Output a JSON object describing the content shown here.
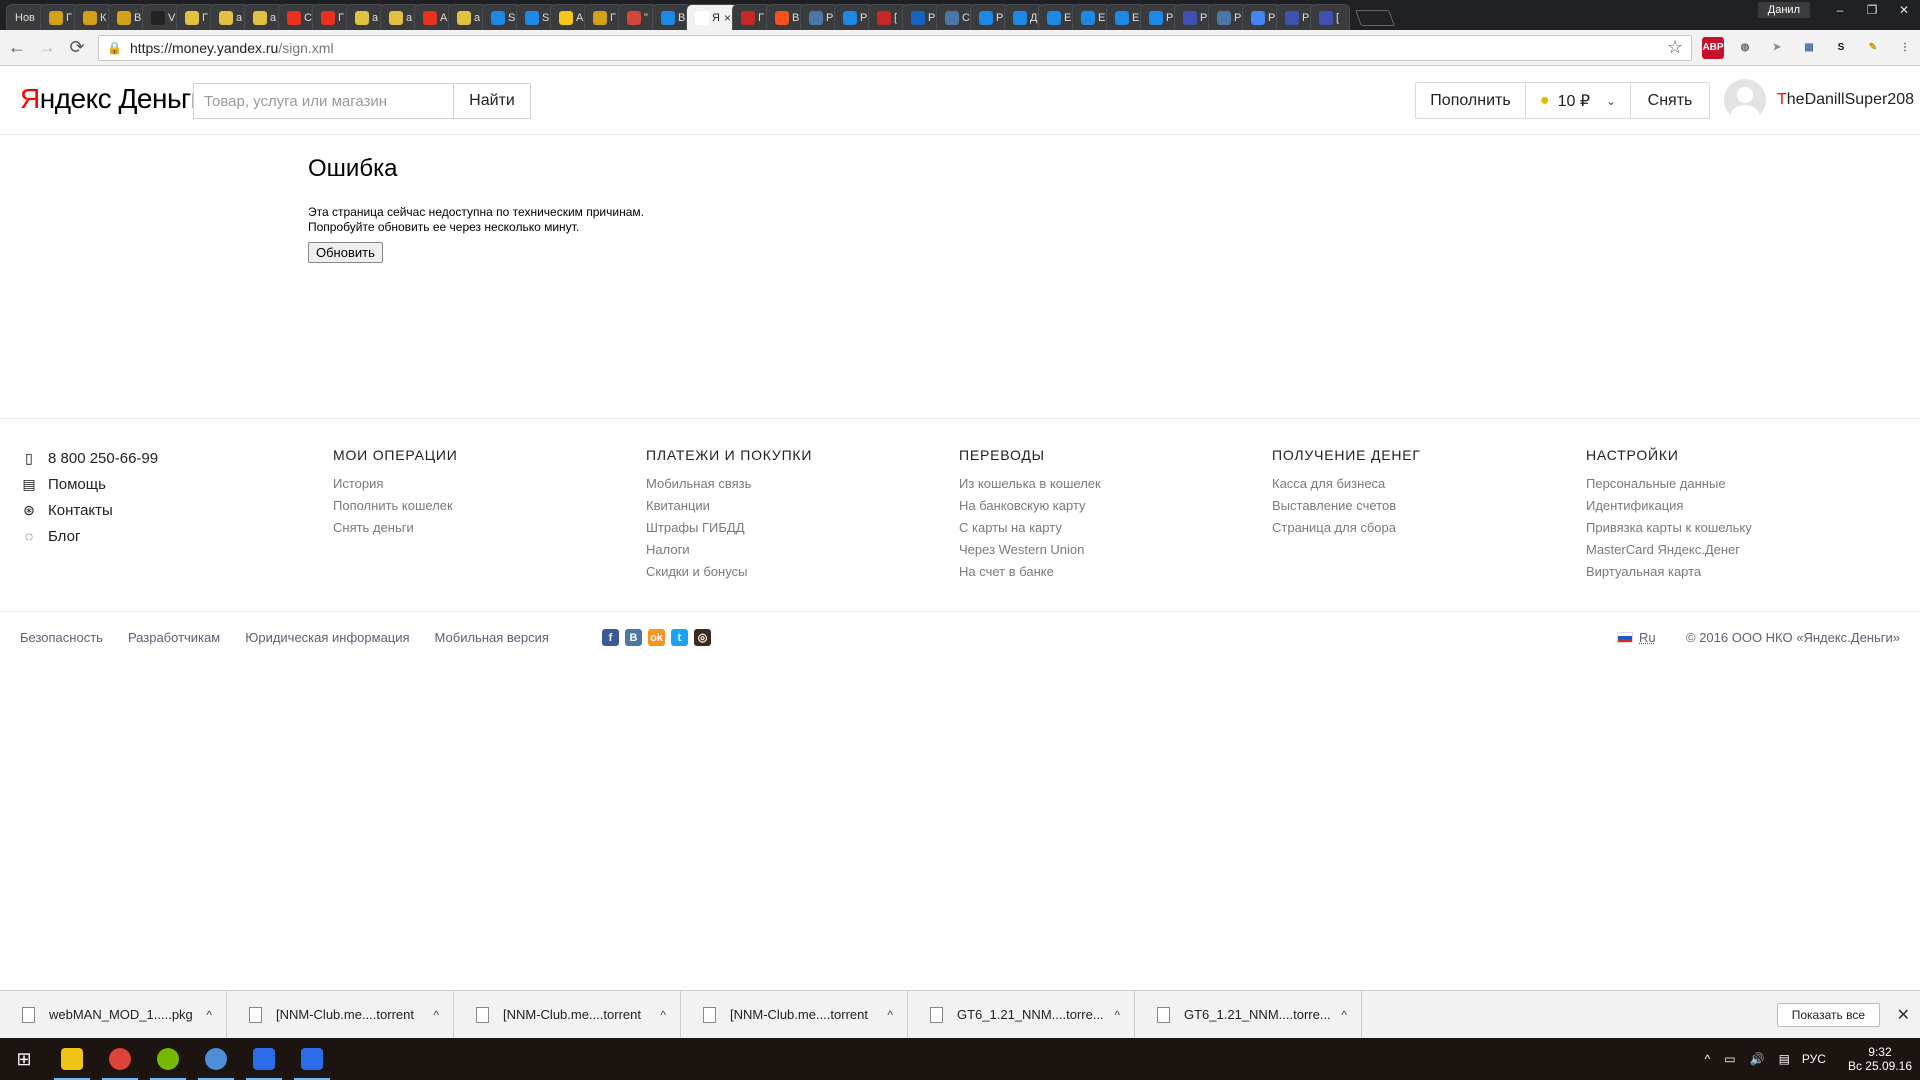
{
  "browser": {
    "tabs": [
      {
        "label": "Нов",
        "color": "#3a3b3d"
      },
      {
        "label": "Г",
        "color": "#d4a017"
      },
      {
        "label": "К",
        "color": "#d4a017"
      },
      {
        "label": "В",
        "color": "#d4a017"
      },
      {
        "label": "V",
        "color": "#222222"
      },
      {
        "label": "Г",
        "color": "#e0c040"
      },
      {
        "label": "a",
        "color": "#e0c040"
      },
      {
        "label": "a",
        "color": "#e0c040"
      },
      {
        "label": "С",
        "color": "#e8321e"
      },
      {
        "label": "Г",
        "color": "#e8321e"
      },
      {
        "label": "a",
        "color": "#e0c040"
      },
      {
        "label": "a",
        "color": "#e0c040"
      },
      {
        "label": "А",
        "color": "#e8321e"
      },
      {
        "label": "a",
        "color": "#e0c040"
      },
      {
        "label": "S",
        "color": "#1e88e5"
      },
      {
        "label": "S",
        "color": "#1e88e5"
      },
      {
        "label": "А",
        "color": "#f5c518"
      },
      {
        "label": "Г",
        "color": "#d4a017"
      },
      {
        "label": "\"",
        "color": "#d44638"
      },
      {
        "label": "В",
        "color": "#1e88e5"
      },
      {
        "label": "Я",
        "color": "#ffffff",
        "active": true
      },
      {
        "label": "Г",
        "color": "#c62828"
      },
      {
        "label": "В",
        "color": "#f4511e"
      },
      {
        "label": "Р",
        "color": "#4a76a8"
      },
      {
        "label": "Р",
        "color": "#1e88e5"
      },
      {
        "label": "[",
        "color": "#c62828"
      },
      {
        "label": "Р",
        "color": "#1565c0"
      },
      {
        "label": "С",
        "color": "#4a76a8"
      },
      {
        "label": "Р",
        "color": "#1e88e5"
      },
      {
        "label": "Д",
        "color": "#1e88e5"
      },
      {
        "label": "Е",
        "color": "#1e88e5"
      },
      {
        "label": "Е",
        "color": "#1e88e5"
      },
      {
        "label": "Е",
        "color": "#1e88e5"
      },
      {
        "label": "Р",
        "color": "#1e88e5"
      },
      {
        "label": "Р",
        "color": "#3f51b5"
      },
      {
        "label": "Р",
        "color": "#4a76a8"
      },
      {
        "label": "Р",
        "color": "#4285f4"
      },
      {
        "label": "Р",
        "color": "#3f51b5"
      },
      {
        "label": "[",
        "color": "#3f51b5"
      }
    ],
    "tab_close": "×",
    "window_user": "Данил",
    "window_controls": {
      "minimize": "–",
      "maximize": "❐",
      "close": "✕"
    },
    "back": "←",
    "forward": "→",
    "reload": "⟳",
    "url_host": "https://money.yandex.ru",
    "url_path": "/sign.xml",
    "star": "☆",
    "extensions": [
      {
        "label": "ABP",
        "color": "#c8102e",
        "text_color": "#ffffff"
      },
      {
        "label": "◍",
        "color": "#f2f2f2",
        "text_color": "#666666"
      },
      {
        "label": "➤",
        "color": "#f2f2f2",
        "text_color": "#888888"
      },
      {
        "label": "▦",
        "color": "#f2f2f2",
        "text_color": "#4a76a8"
      },
      {
        "label": "S",
        "color": "#f2f2f2",
        "text_color": "#111111"
      },
      {
        "label": "✎",
        "color": "#f2f2f2",
        "text_color": "#c59b00"
      },
      {
        "label": "⋮",
        "color": "#f2f2f2",
        "text_color": "#555555"
      }
    ]
  },
  "header": {
    "logo_first": "Я",
    "logo_rest": "ндекс Деньги",
    "search_placeholder": "Товар, услуга или магазин",
    "search_button": "Найти",
    "topup": "Пополнить",
    "coin": "●",
    "balance": "10 ₽",
    "chevron": "⌄",
    "withdraw": "Снять",
    "username_first": "T",
    "username_rest": "heDanillSuper208"
  },
  "error": {
    "title": "Ошибка",
    "line1": "Эта страница сейчас недоступна по техническим причинам.",
    "line2": "Попробуйте обновить ее через несколько минут.",
    "refresh": "Обновить"
  },
  "footer": {
    "contacts": [
      {
        "icon": "▯",
        "label": "8 800 250-66-99"
      },
      {
        "icon": "▤",
        "label": "Помощь"
      },
      {
        "icon": "⊛",
        "label": "Контакты"
      },
      {
        "icon": "◌",
        "label": "Блог"
      }
    ],
    "columns": [
      {
        "title": "МОИ ОПЕРАЦИИ",
        "links": [
          "История",
          "Пополнить кошелек",
          "Снять деньги"
        ]
      },
      {
        "title": "ПЛАТЕЖИ И ПОКУПКИ",
        "links": [
          "Мобильная связь",
          "Квитанции",
          "Штрафы ГИБДД",
          "Налоги",
          "Скидки и бонусы"
        ]
      },
      {
        "title": "ПЕРЕВОДЫ",
        "links": [
          "Из кошелька в кошелек",
          "На банковскую карту",
          "С карты на карту",
          "Через Western Union",
          "На счет в банке"
        ]
      },
      {
        "title": "ПОЛУЧЕНИЕ ДЕНЕГ",
        "links": [
          "Касса для бизнеса",
          "Выставление счетов",
          "Страница для сбора"
        ]
      },
      {
        "title": "НАСТРОЙКИ",
        "links": [
          "Персональные данные",
          "Идентификация",
          "Привязка карты к кошельку",
          "MasterCard Яндекс.Денег",
          "Виртуальная карта"
        ]
      }
    ],
    "bottom_links": [
      "Безопасность",
      "Разработчикам",
      "Юридическая информация",
      "Мобильная версия"
    ],
    "social": [
      {
        "label": "f",
        "color": "#3b5998"
      },
      {
        "label": "В",
        "color": "#4a76a8"
      },
      {
        "label": "ok",
        "color": "#f7931e"
      },
      {
        "label": "t",
        "color": "#1da1f2"
      },
      {
        "label": "◎",
        "color": "#3f2a1e"
      }
    ],
    "language": "Ru",
    "copyright": "© 2016 ООО НКО «Яндекс.Деньги»"
  },
  "downloads": {
    "items": [
      {
        "name": "webMAN_MOD_1.....pkg"
      },
      {
        "name": "[NNM-Club.me....torrent"
      },
      {
        "name": "[NNM-Club.me....torrent"
      },
      {
        "name": "[NNM-Club.me....torrent"
      },
      {
        "name": "GT6_1.21_NNM....torre..."
      },
      {
        "name": "GT6_1.21_NNM....torre..."
      }
    ],
    "caret": "^",
    "show_all": "Показать все",
    "close": "✕"
  },
  "taskbar": {
    "start": "⊞",
    "apps": [
      {
        "name": "file-explorer",
        "color": "#f0c419",
        "running": true
      },
      {
        "name": "chrome",
        "color": "#db4437",
        "running": true
      },
      {
        "name": "utorrent",
        "color": "#76b900",
        "running": true
      },
      {
        "name": "browser",
        "color": "#4a8fd8",
        "running": true
      },
      {
        "name": "app-blue-1",
        "color": "#2b6de8",
        "running": true
      },
      {
        "name": "app-blue-2",
        "color": "#2b6de8",
        "running": true
      }
    ],
    "tray_icons": [
      "^",
      "▭",
      "🔊",
      "▤"
    ],
    "lang": "РУС",
    "time": "9:32",
    "date": "Вс 25.09.16"
  }
}
